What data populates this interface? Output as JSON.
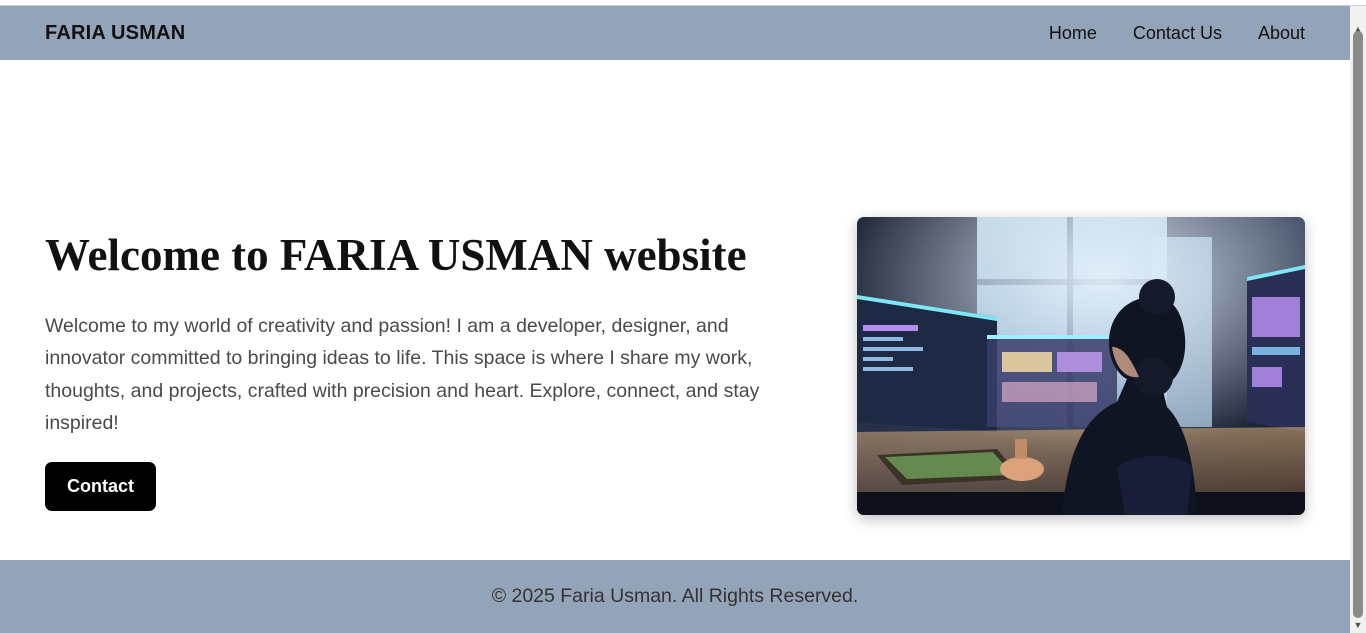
{
  "navbar": {
    "brand": "FARIA USMAN",
    "links": [
      "Home",
      "Contact Us",
      "About"
    ]
  },
  "hero": {
    "title": "Welcome to FARIA USMAN website",
    "description": "Welcome to my world of creativity and passion! I am a developer, designer, and innovator committed to bringing ideas to life. This space is where I share my work, thoughts, and projects, crafted with precision and heart. Explore, connect, and stay inspired!",
    "cta_label": "Contact",
    "image_subject": "anime-girl-at-computer-illustration"
  },
  "footer": {
    "text": "© 2025 Faria Usman. All Rights Reserved."
  },
  "colors": {
    "navbar_bg": "#93a3b8",
    "footer_bg": "#93a3b8",
    "cta_bg": "#000000",
    "cta_text": "#ffffff"
  }
}
